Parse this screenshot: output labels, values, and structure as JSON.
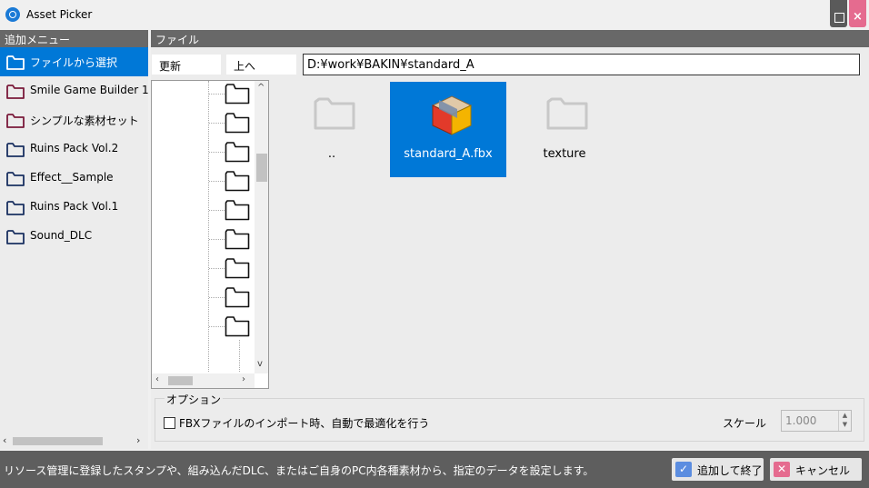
{
  "window": {
    "title": "Asset Picker"
  },
  "sidebar": {
    "header": "追加メニュー",
    "items": [
      {
        "label": "ファイルから選択",
        "selected": true,
        "folder_color": "#0078d7"
      },
      {
        "label": "Smile Game Builder 1",
        "selected": false,
        "folder_color": "#7a1a3a"
      },
      {
        "label": "シンプルな素材セット",
        "selected": false,
        "folder_color": "#7a1a3a"
      },
      {
        "label": "Ruins Pack Vol.2",
        "selected": false,
        "folder_color": "#1a3060"
      },
      {
        "label": "Effect__Sample",
        "selected": false,
        "folder_color": "#1a3060"
      },
      {
        "label": "Ruins Pack Vol.1",
        "selected": false,
        "folder_color": "#1a3060"
      },
      {
        "label": "Sound_DLC",
        "selected": false,
        "folder_color": "#1a3060"
      }
    ]
  },
  "file_panel": {
    "header": "ファイル",
    "refresh_label": "更新",
    "up_label": "上へ",
    "path": "D:¥work¥BAKIN¥standard_A",
    "files": [
      {
        "label": "..",
        "type": "folder",
        "selected": false
      },
      {
        "label": "standard_A.fbx",
        "type": "model",
        "selected": true
      },
      {
        "label": "texture",
        "type": "folder",
        "selected": false
      }
    ]
  },
  "options": {
    "legend": "オプション",
    "auto_optimize_label": "FBXファイルのインポート時、自動で最適化を行う",
    "auto_optimize_checked": false,
    "scale_label": "スケール",
    "scale_value": "1.000"
  },
  "status": {
    "text": "リソース管理に登録したスタンプや、組み込んだDLC、またはご自身のPC内各種素材から、指定のデータを設定します。",
    "ok_label": "追加して終了",
    "cancel_label": "キャンセル"
  },
  "colors": {
    "accent": "#0078d7",
    "header_bg": "#686868",
    "close_button": "#e56b8f"
  }
}
